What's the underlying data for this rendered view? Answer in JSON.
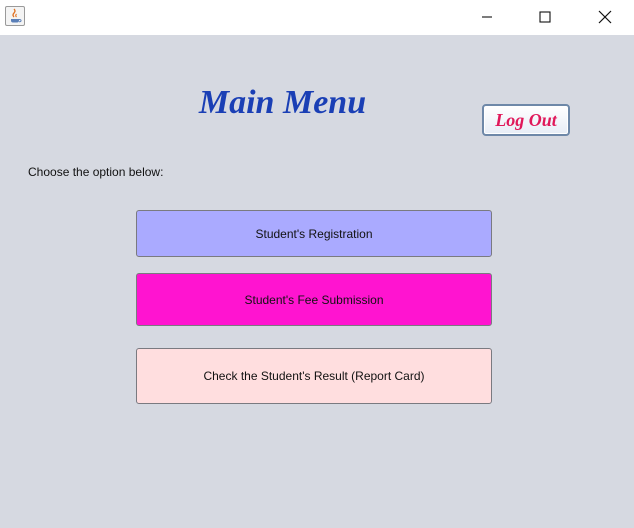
{
  "window": {
    "icon": "java-app-icon",
    "controls": {
      "minimize_icon": "minimize-icon",
      "maximize_icon": "maximize-icon",
      "close_icon": "close-icon"
    }
  },
  "header": {
    "title": "Main Menu",
    "logout_label": "Log Out"
  },
  "main": {
    "prompt": "Choose the option below:",
    "options": [
      {
        "label": "Student's Registration",
        "color": "#aaaaff"
      },
      {
        "label": "Student's Fee Submission",
        "color": "#ff14d0"
      },
      {
        "label": "Check the Student's Result (Report Card)",
        "color": "#ffdedf"
      }
    ]
  },
  "colors": {
    "title": "#1a3fb5",
    "logout_text": "#e0185a",
    "background": "#d6d9e1"
  }
}
